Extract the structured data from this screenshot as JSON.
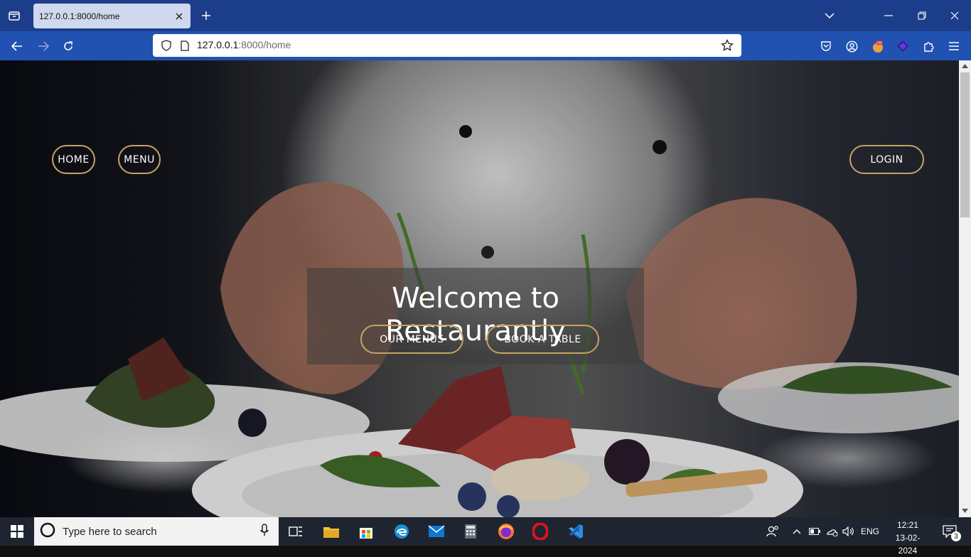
{
  "browser": {
    "tab_title": "127.0.0.1:8000/home",
    "url_host": "127.0.0.1",
    "url_path": ":8000/home"
  },
  "page": {
    "nav": {
      "home_label": "HOME",
      "menu_label": "MENU",
      "login_label": "LOGIN"
    },
    "hero": {
      "title": "Welcome to Restaurantly",
      "our_menus_label": "OUR MENUS",
      "book_table_label": "BOOK A TABLE"
    },
    "accent_color": "#c8a266"
  },
  "taskbar": {
    "search_placeholder": "Type here to search",
    "language": "ENG",
    "time": "12:21",
    "date": "13-02-2024",
    "notification_count": "3"
  }
}
